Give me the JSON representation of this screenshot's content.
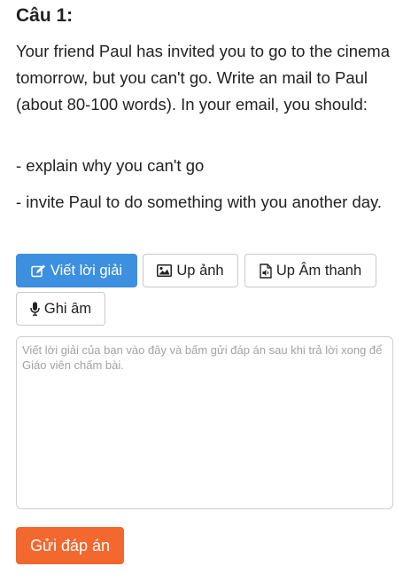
{
  "question": {
    "title": "Câu 1:",
    "prompt": "Your friend Paul has invited you to go to the cinema tomorrow, but you can't go. Write an mail to Paul (about 80-100 words). In your email, you should:",
    "points": [
      "- explain why you can't go",
      "- invite Paul to do something with you another day."
    ]
  },
  "answer_modes": {
    "write_label": "Viết lời giải",
    "image_label": "Up ảnh",
    "audio_label": "Up Âm thanh",
    "record_label": "Ghi âm",
    "active": "write"
  },
  "answer_box": {
    "value": "",
    "placeholder": "Viết lời giải của bạn vào đây và bấm gửi đáp án sau khi trả lời xong để Giáo viên chấm bài."
  },
  "submit_label": "Gửi đáp án",
  "colors": {
    "active_button": "#3d8fe0",
    "submit_button": "#f2682f",
    "text": "#222222"
  }
}
